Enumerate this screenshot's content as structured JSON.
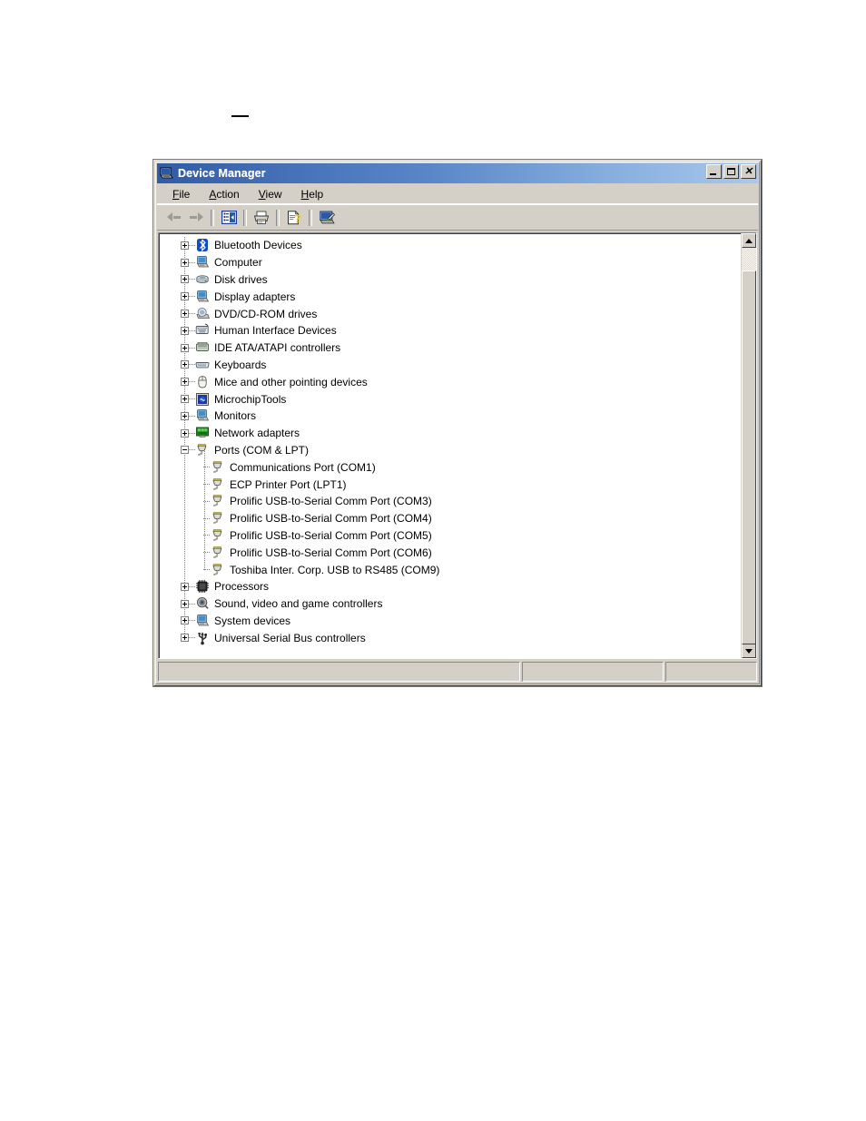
{
  "window": {
    "title": "Device Manager",
    "title_icon": "device-manager-icon",
    "controls": {
      "minimize": "_",
      "maximize": "□",
      "close": "✕"
    }
  },
  "menubar": {
    "items": [
      {
        "label": "File",
        "accel": "F",
        "name": "menu-file"
      },
      {
        "label": "Action",
        "accel": "A",
        "name": "menu-action"
      },
      {
        "label": "View",
        "accel": "V",
        "name": "menu-view"
      },
      {
        "label": "Help",
        "accel": "H",
        "name": "menu-help"
      }
    ]
  },
  "toolbar": {
    "buttons": [
      {
        "name": "back-button",
        "icon": "left-arrow-icon",
        "enabled": false
      },
      {
        "name": "forward-button",
        "icon": "right-arrow-icon",
        "enabled": false
      },
      {
        "name": "show-hide-console-tree-button",
        "icon": "console-tree-icon"
      },
      {
        "name": "print-button",
        "icon": "printer-icon"
      },
      {
        "name": "properties-button",
        "icon": "properties-help-icon"
      },
      {
        "name": "scan-for-hardware-changes-button",
        "icon": "scan-hardware-icon"
      }
    ]
  },
  "tree": {
    "items": [
      {
        "label": "Bluetooth Devices",
        "level": 1,
        "state": "collapsed",
        "icon": "bluetooth-icon"
      },
      {
        "label": "Computer",
        "level": 1,
        "state": "collapsed",
        "icon": "computer-icon"
      },
      {
        "label": "Disk drives",
        "level": 1,
        "state": "collapsed",
        "icon": "disk-drive-icon"
      },
      {
        "label": "Display adapters",
        "level": 1,
        "state": "collapsed",
        "icon": "display-adapter-icon"
      },
      {
        "label": "DVD/CD-ROM drives",
        "level": 1,
        "state": "collapsed",
        "icon": "dvd-drive-icon"
      },
      {
        "label": "Human Interface Devices",
        "level": 1,
        "state": "collapsed",
        "icon": "hid-icon"
      },
      {
        "label": "IDE ATA/ATAPI controllers",
        "level": 1,
        "state": "collapsed",
        "icon": "ide-controller-icon"
      },
      {
        "label": "Keyboards",
        "level": 1,
        "state": "collapsed",
        "icon": "keyboard-icon"
      },
      {
        "label": "Mice and other pointing devices",
        "level": 1,
        "state": "collapsed",
        "icon": "mouse-icon"
      },
      {
        "label": "MicrochipTools",
        "level": 1,
        "state": "collapsed",
        "icon": "microchip-tools-icon"
      },
      {
        "label": "Monitors",
        "level": 1,
        "state": "collapsed",
        "icon": "monitor-icon"
      },
      {
        "label": "Network adapters",
        "level": 1,
        "state": "collapsed",
        "icon": "network-adapter-icon"
      },
      {
        "label": "Ports (COM & LPT)",
        "level": 1,
        "state": "expanded",
        "icon": "port-icon"
      },
      {
        "label": "Communications Port (COM1)",
        "level": 2,
        "state": "leaf",
        "icon": "port-icon"
      },
      {
        "label": "ECP Printer Port (LPT1)",
        "level": 2,
        "state": "leaf",
        "icon": "port-icon"
      },
      {
        "label": "Prolific USB-to-Serial Comm Port (COM3)",
        "level": 2,
        "state": "leaf",
        "icon": "port-icon"
      },
      {
        "label": "Prolific USB-to-Serial Comm Port (COM4)",
        "level": 2,
        "state": "leaf",
        "icon": "port-icon"
      },
      {
        "label": "Prolific USB-to-Serial Comm Port (COM5)",
        "level": 2,
        "state": "leaf",
        "icon": "port-icon"
      },
      {
        "label": "Prolific USB-to-Serial Comm Port (COM6)",
        "level": 2,
        "state": "leaf",
        "icon": "port-icon"
      },
      {
        "label": "Toshiba Inter. Corp. USB to RS485 (COM9)",
        "level": 2,
        "state": "leaf",
        "icon": "port-icon"
      },
      {
        "label": "Processors",
        "level": 1,
        "state": "collapsed",
        "icon": "processor-icon"
      },
      {
        "label": "Sound, video and game controllers",
        "level": 1,
        "state": "collapsed",
        "icon": "sound-controller-icon"
      },
      {
        "label": "System devices",
        "level": 1,
        "state": "collapsed",
        "icon": "system-device-icon"
      },
      {
        "label": "Universal Serial Bus controllers",
        "level": 1,
        "state": "collapsed",
        "icon": "usb-controller-icon"
      }
    ]
  },
  "scrollbar": {
    "up_icon": "scroll-up-arrow-icon",
    "down_icon": "scroll-down-arrow-icon"
  },
  "statusbar": {
    "panes": [
      "",
      "",
      ""
    ]
  },
  "colors": {
    "title_gradient_start": "#2f5ba8",
    "title_gradient_end": "#a9c8ec",
    "window_face": "#d4d0c8",
    "pane_background": "#ffffff"
  }
}
